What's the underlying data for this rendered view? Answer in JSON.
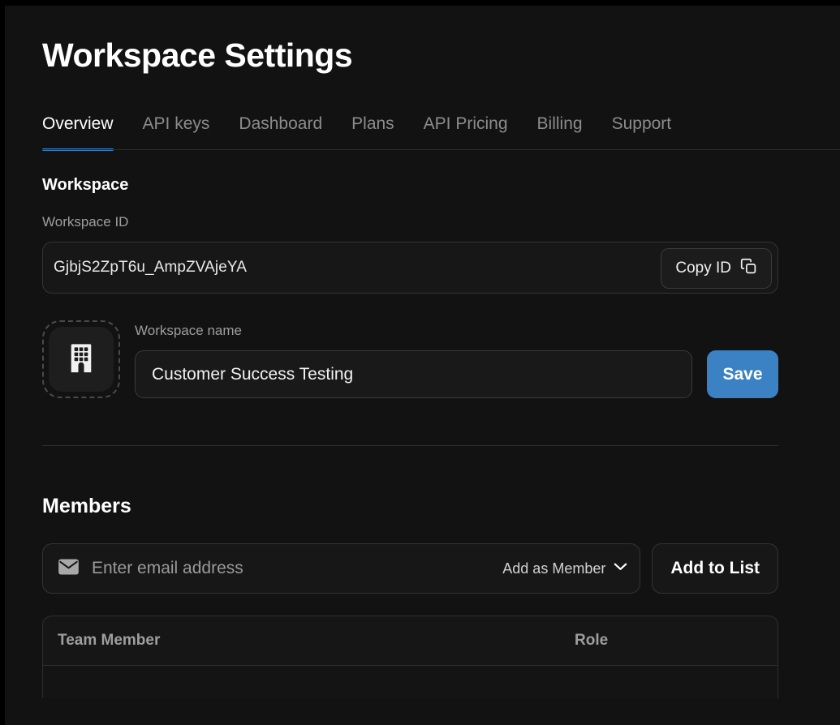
{
  "header": {
    "title": "Workspace Settings"
  },
  "tabs": [
    {
      "label": "Overview",
      "active": true
    },
    {
      "label": "API keys",
      "active": false
    },
    {
      "label": "Dashboard",
      "active": false
    },
    {
      "label": "Plans",
      "active": false
    },
    {
      "label": "API Pricing",
      "active": false
    },
    {
      "label": "Billing",
      "active": false
    },
    {
      "label": "Support",
      "active": false
    }
  ],
  "workspace": {
    "section_title": "Workspace",
    "id_label": "Workspace ID",
    "id_value": "GjbjS2ZpT6u_AmpZVAjeYA",
    "copy_button_label": "Copy ID",
    "copy_icon": "copy-icon",
    "avatar_icon": "building-icon",
    "name_label": "Workspace name",
    "name_value": "Customer Success Testing",
    "save_button_label": "Save"
  },
  "members": {
    "section_title": "Members",
    "email_icon": "envelope-icon",
    "email_placeholder": "Enter email address",
    "email_value": "",
    "role_selected": "Add as Member",
    "role_chevron_icon": "chevron-down-icon",
    "add_button_label": "Add to List",
    "table": {
      "columns": [
        "Team Member",
        "Role"
      ],
      "rows": []
    }
  },
  "colors": {
    "accent": "#3b82c4",
    "page_bg": "#121212",
    "panel_bg": "#171717",
    "border": "#343434",
    "text_primary": "#ffffff",
    "text_muted": "#9e9e9e"
  }
}
